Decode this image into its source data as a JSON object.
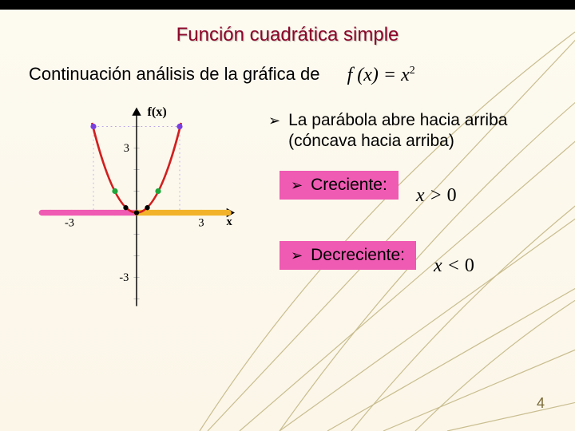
{
  "title": "Función cuadrática simple",
  "subtitle": "Continuación análisis de la gráfica de",
  "formula_lhs": "f (x)",
  "formula_rhs": "x",
  "formula_exp": "2",
  "bullets": {
    "concave_line1": "La parábola abre hacia arriba",
    "concave_line2": "(cóncava hacia arriba)",
    "creciente": "Creciente:",
    "decreciente": "Decreciente:"
  },
  "inequalities": {
    "creciente_var": "x",
    "creciente_op": ">",
    "creciente_val": "0",
    "decreciente_var": "x",
    "decreciente_op": "<",
    "decreciente_val": "0"
  },
  "graph": {
    "y_label": "f(x)",
    "x_label": "x",
    "tick_y_pos": "3",
    "tick_y_neg": "-3",
    "tick_x_pos": "3",
    "tick_x_neg": "-3"
  },
  "page_number": "4",
  "chart_data": {
    "type": "line",
    "title": "f(x) = x^2",
    "xlabel": "x",
    "ylabel": "f(x)",
    "xlim": [
      -4,
      4
    ],
    "ylim": [
      -4,
      4
    ],
    "x": [
      -2.0,
      -1.5,
      -1.0,
      -0.5,
      0.0,
      0.5,
      1.0,
      1.5,
      2.0
    ],
    "values": [
      4.0,
      2.25,
      1.0,
      0.25,
      0.0,
      0.25,
      1.0,
      2.25,
      4.0
    ],
    "markers": {
      "purple": [
        [
          -2,
          4
        ],
        [
          2,
          4
        ]
      ],
      "green": [
        [
          -1,
          1
        ],
        [
          1,
          1
        ]
      ],
      "black": [
        [
          -0.5,
          0.25
        ],
        [
          0,
          0
        ],
        [
          0.5,
          0.25
        ]
      ]
    },
    "annotations": {
      "pink_segment_y0_from_x": -4.2,
      "pink_segment_y0_to_x": 0,
      "orange_segment_y0_from_x": 0,
      "orange_segment_y0_to_x": 4.2
    }
  }
}
